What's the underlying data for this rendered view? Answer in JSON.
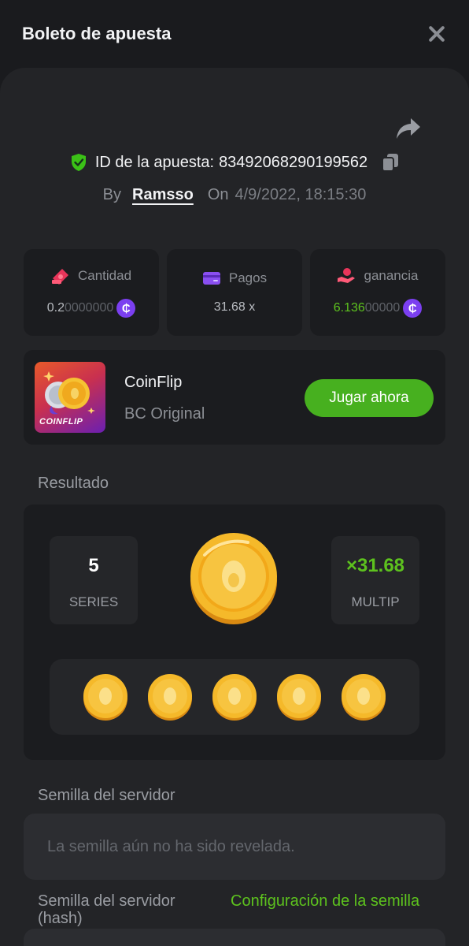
{
  "header": {
    "title": "Boleto de apuesta"
  },
  "bet": {
    "id_label": "ID de la apuesta:",
    "id_value": "83492068290199562",
    "by_label": "By",
    "user": "Ramsso",
    "on_label": "On",
    "date": "4/9/2022, 18:15:30"
  },
  "stats": [
    {
      "label": "Cantidad",
      "value_main": "0.2",
      "value_dim": "0000000",
      "icon": "money-icon"
    },
    {
      "label": "Pagos",
      "value_main": "31.68 x",
      "icon": "card-icon"
    },
    {
      "label": "ganancia",
      "value_main": "6.136",
      "value_dim": "00000",
      "icon": "hand-coin-icon"
    }
  ],
  "game": {
    "name": "CoinFlip",
    "subtitle": "BC Original",
    "thumb_text": "COINFLIP",
    "play_label": "Jugar ahora"
  },
  "result": {
    "section_label": "Resultado",
    "series_value": "5",
    "series_label": "SERIES",
    "multiplier_value": "×31.68",
    "multiplier_label": "MULTIP",
    "coin_count": 5
  },
  "seed": {
    "server_label": "Semilla del servidor",
    "server_placeholder": "La semilla aún no ha sido revelada.",
    "hash_label": "Semilla del servidor (hash)",
    "config_link": "Configuración de la semilla"
  },
  "colors": {
    "accent_green": "#5dc21e",
    "coin_purple": "#7b3ff0",
    "panel_bg": "#232427",
    "card_bg": "#1b1c1f"
  }
}
